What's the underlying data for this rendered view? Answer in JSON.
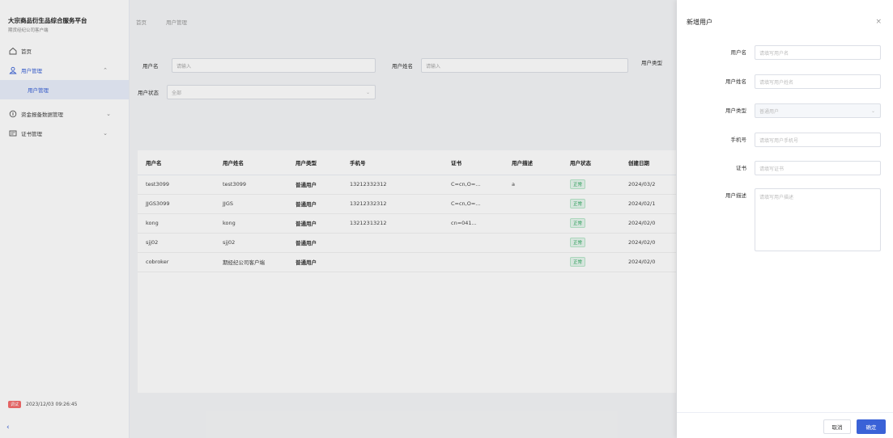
{
  "brand": {
    "title": "大宗商品衍生品综合服务平台",
    "subtitle": "期货经纪公司客户端"
  },
  "sidebar": {
    "items": [
      {
        "label": "首页",
        "icon": "home-icon"
      },
      {
        "label": "用户管理",
        "icon": "user-icon",
        "open": true
      },
      {
        "label": "资金报备数据管理",
        "icon": "data-icon"
      },
      {
        "label": "证书管理",
        "icon": "certificate-icon"
      }
    ],
    "sub_item": "用户管理",
    "footer_badge": "调试",
    "footer_time": "2023/12/03 09:26:45"
  },
  "breadcrumb": {
    "home": "首页",
    "current": "用户管理"
  },
  "search": {
    "username_label": "用户名",
    "username_placeholder": "请输入",
    "realname_label": "用户姓名",
    "realname_placeholder": "请输入",
    "type_label": "用户类型",
    "status_label": "用户状态",
    "status_value": "全部"
  },
  "table": {
    "headers": [
      "用户名",
      "用户姓名",
      "用户类型",
      "手机号",
      "证书",
      "用户描述",
      "用户状态",
      "创建日期"
    ],
    "rows": [
      [
        "test3099",
        "test3099",
        "普通用户",
        "13212332312",
        "C=cn,O=...",
        "a",
        "正常",
        "2024/03/2"
      ],
      [
        "JJGS3099",
        "JJGS",
        "普通用户",
        "13212332312",
        "C=cn,O=...",
        "",
        "正常",
        "2024/02/1"
      ],
      [
        "kong",
        "kong",
        "普通用户",
        "13212313212",
        "cn=041...",
        "",
        "正常",
        "2024/02/0"
      ],
      [
        "sjj02",
        "sjj02",
        "普通用户",
        "",
        "",
        "",
        "正常",
        "2024/02/0"
      ],
      [
        "cobroker",
        "期经纪公司客户端",
        "普通用户",
        "",
        "",
        "",
        "正常",
        "2024/02/0"
      ]
    ]
  },
  "drawer": {
    "title": "新增用户",
    "close": "×",
    "fields": {
      "username_label": "用户名",
      "username_placeholder": "请填写用户名",
      "realname_label": "用户姓名",
      "realname_placeholder": "请填写用户姓名",
      "type_label": "用户类型",
      "type_value": "普通用户",
      "phone_label": "手机号",
      "phone_placeholder": "请填写用户手机号",
      "cert_label": "证书",
      "cert_placeholder": "请填写证书",
      "desc_label": "用户描述",
      "desc_placeholder": "请填写用户描述"
    },
    "cancel": "取消",
    "ok": "确定"
  },
  "colors": {
    "primary": "#3a62d7",
    "status_green": "#2aa65c",
    "badge_red": "#f56c6c"
  }
}
